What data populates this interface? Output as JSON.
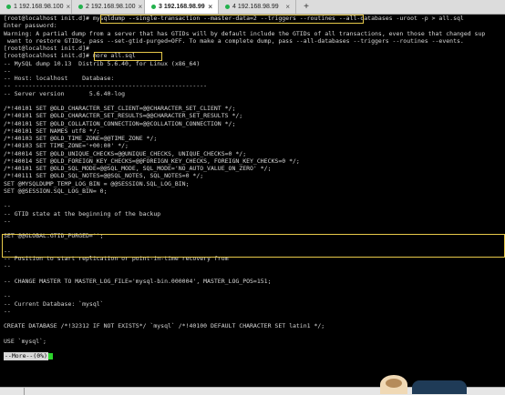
{
  "tabs": [
    {
      "label": "1 192.168.98.100",
      "dot_color": "#22b14c",
      "active": false
    },
    {
      "label": "2 192.168.98.100",
      "dot_color": "#22b14c",
      "active": false
    },
    {
      "label": "3 192.168.98.99",
      "dot_color": "#22b14c",
      "active": true
    },
    {
      "label": "4 192.168.98.99",
      "dot_color": "#22b14c",
      "active": false
    }
  ],
  "new_tab_label": "+",
  "close_label": "×",
  "terminal_lines": [
    "[root@localhost init.d]# mysqldump --single-transaction --master-data=2 --triggers --routines --all-databases -uroot -p > all.sql",
    "Enter password:",
    "Warning: A partial dump from a server that has GTIDs will by default include the GTIDs of all transactions, even those that changed sup",
    " want to restore GTIDs, pass --set-gtid-purged=OFF. To make a complete dump, pass --all-databases --triggers --routines --events.",
    "[root@localhost init.d]#",
    "[root@localhost init.d]# more all.sql",
    "-- MySQL dump 10.13  Distrib 5.6.40, for Linux (x86_64)",
    "--",
    "-- Host: localhost    Database:",
    "-- ------------------------------------------------------",
    "-- Server version       5.6.40-log",
    "",
    "/*!40101 SET @OLD_CHARACTER_SET_CLIENT=@@CHARACTER_SET_CLIENT */;",
    "/*!40101 SET @OLD_CHARACTER_SET_RESULTS=@@CHARACTER_SET_RESULTS */;",
    "/*!40101 SET @OLD_COLLATION_CONNECTION=@@COLLATION_CONNECTION */;",
    "/*!40101 SET NAMES utf8 */;",
    "/*!40103 SET @OLD_TIME_ZONE=@@TIME_ZONE */;",
    "/*!40103 SET TIME_ZONE='+00:00' */;",
    "/*!40014 SET @OLD_UNIQUE_CHECKS=@@UNIQUE_CHECKS, UNIQUE_CHECKS=0 */;",
    "/*!40014 SET @OLD_FOREIGN_KEY_CHECKS=@@FOREIGN_KEY_CHECKS, FOREIGN_KEY_CHECKS=0 */;",
    "/*!40101 SET @OLD_SQL_MODE=@@SQL_MODE, SQL_MODE='NO_AUTO_VALUE_ON_ZERO' */;",
    "/*!40111 SET @OLD_SQL_NOTES=@@SQL_NOTES, SQL_NOTES=0 */;",
    "SET @MYSQLDUMP_TEMP_LOG_BIN = @@SESSION.SQL_LOG_BIN;",
    "SET @@SESSION.SQL_LOG_BIN= 0;",
    "",
    "--",
    "-- GTID state at the beginning of the backup",
    "--",
    "",
    "SET @@GLOBAL.GTID_PURGED='';",
    "",
    "--",
    "-- Position to start replication or point-in-time recovery from",
    "--",
    "",
    "-- CHANGE MASTER TO MASTER_LOG_FILE='mysql-bin.000004', MASTER_LOG_POS=151;",
    "",
    "--",
    "-- Current Database: `mysql`",
    "--",
    "",
    "CREATE DATABASE /*!32312 IF NOT EXISTS*/ `mysql` /*!40100 DEFAULT CHARACTER SET latin1 */;",
    "",
    "USE `mysql`;",
    ""
  ],
  "more_prompt": "--More--(0%)",
  "colors": {
    "terminal_bg": "#000000",
    "terminal_fg": "#d8d8d8",
    "highlight": "#e7c94a",
    "cursor": "#2bd42b"
  }
}
